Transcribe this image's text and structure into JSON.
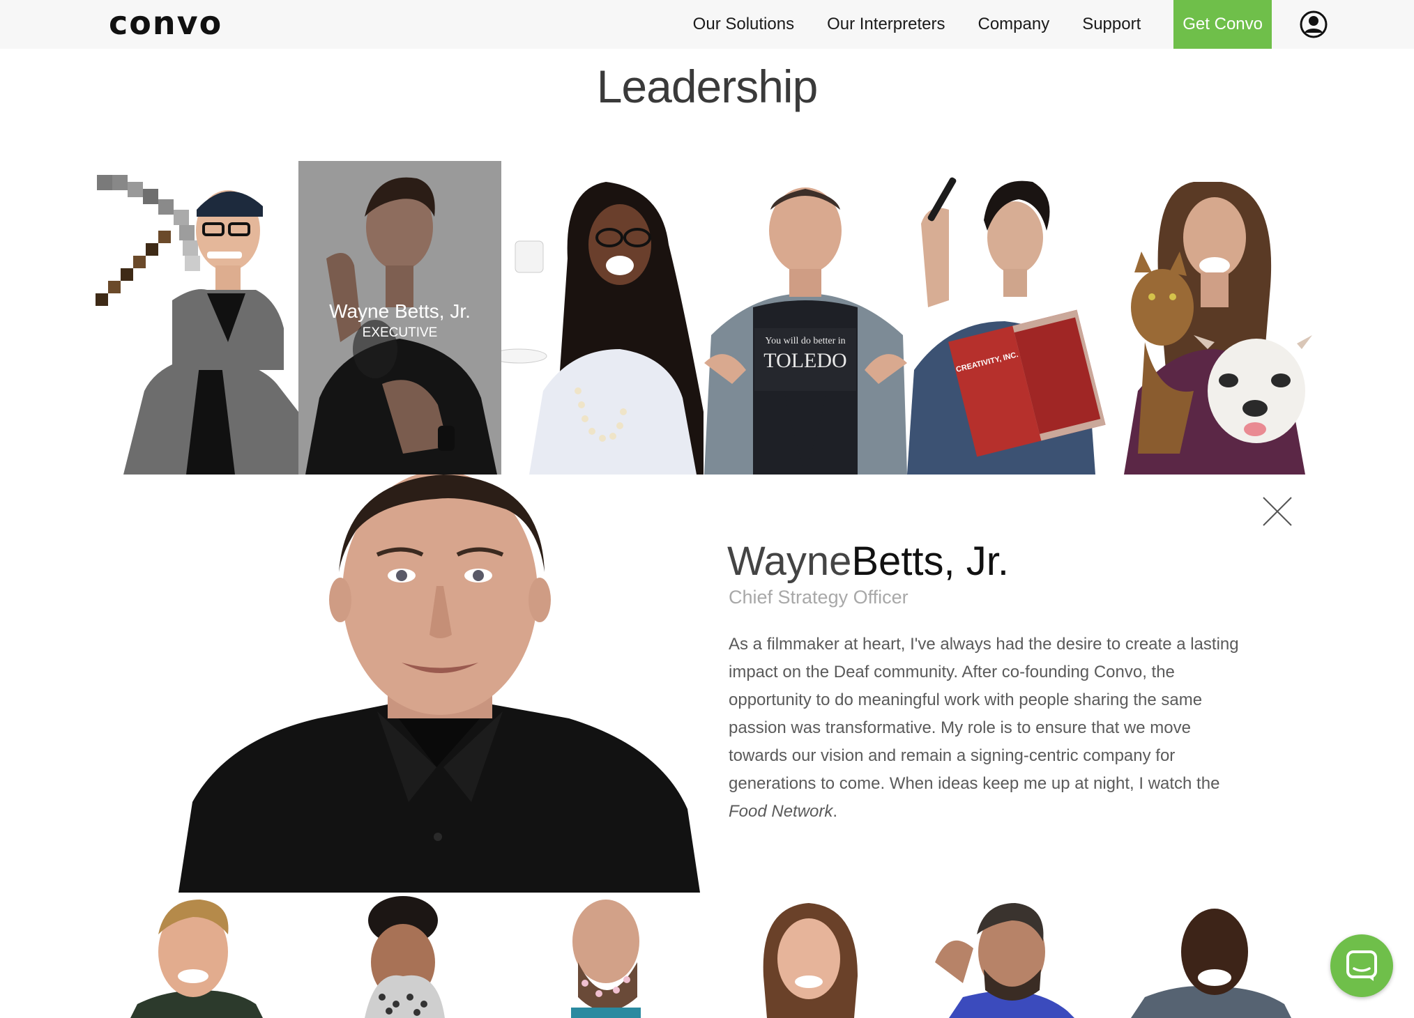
{
  "header": {
    "logo": "convo",
    "nav": [
      "Our Solutions",
      "Our Interpreters",
      "Company",
      "Support"
    ],
    "cta": "Get Convo",
    "account_icon": "user-circle-icon"
  },
  "section_title": "Leadership",
  "selected_tile": {
    "name": "Wayne Betts, Jr.",
    "role": "EXECUTIVE"
  },
  "detail": {
    "first_name": "Wayne",
    "last_name": "Betts, Jr.",
    "title": "Chief Strategy Officer",
    "bio": "As a filmmaker at heart, I've always had the desire to create a lasting impact on the Deaf community. After co-founding Convo, the opportunity to do meaningful work with people sharing the same passion was transformative. My role is to ensure that we move towards our vision and remain a signing-centric company for generations to come. When ideas keep me up at night, I watch the",
    "bio_italic": "Food Network",
    "bio_end": ".",
    "close_icon": "close-icon"
  },
  "tile_texts": {
    "toledo_shirt_line1": "You will do better in",
    "toledo_shirt_line2": "TOLEDO",
    "book_title": "CREATIVITY, INC."
  },
  "chat_icon": "chat-icon",
  "colors": {
    "accent": "#6fbf4a",
    "header_bg": "#f7f7f7",
    "active_tile_bg": "#9a9a9a"
  }
}
